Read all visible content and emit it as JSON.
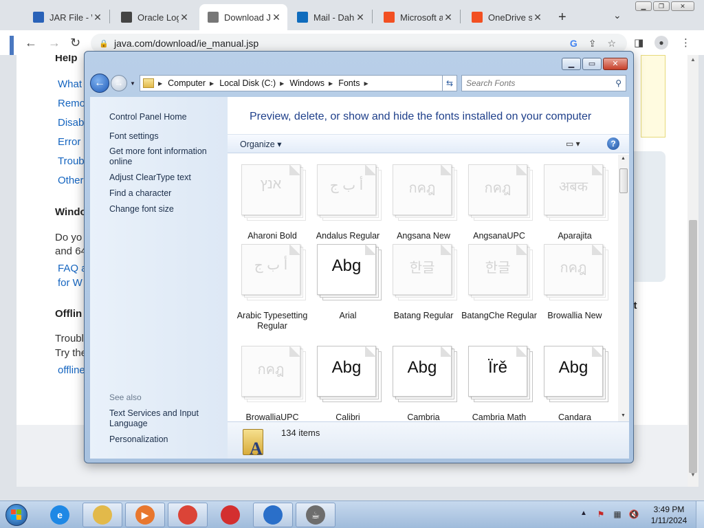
{
  "browser": {
    "tabs": [
      {
        "title": "JAR File - W",
        "favicon": "jar-file-icon",
        "color": "#2962b8"
      },
      {
        "title": "Oracle Login",
        "favicon": "oracle-icon",
        "color": "#444444"
      },
      {
        "title": "Download J",
        "favicon": "java-icon",
        "color": "#777777",
        "active": true
      },
      {
        "title": "Mail - Dahu",
        "favicon": "outlook-icon",
        "color": "#0f6cbd"
      },
      {
        "title": "Microsoft a",
        "favicon": "microsoft-icon",
        "color": "#f25022"
      },
      {
        "title": "OneDrive sy",
        "favicon": "microsoft-icon",
        "color": "#f25022"
      }
    ],
    "new_tab": "+",
    "url": "java.com/download/ie_manual.jsp"
  },
  "page": {
    "help_heading": "Help",
    "help_links": [
      "What",
      "Remo",
      "Disab",
      "Error",
      "Troub",
      "Other"
    ],
    "windows_heading": "Windo",
    "windows_text": [
      "Do yo",
      "and 64"
    ],
    "faq_links": [
      "FAQ a",
      "for W"
    ],
    "offline_heading": "Offlin",
    "offline_text": [
      "Troubl",
      "Try the"
    ],
    "offline_link": "offline",
    "start_text": "start"
  },
  "explorer": {
    "breadcrumbs": [
      "Computer",
      "Local Disk (C:)",
      "Windows",
      "Fonts"
    ],
    "search_placeholder": "Search Fonts",
    "nav": {
      "home": "Control Panel Home",
      "links": [
        "Font settings",
        "Get more font information online",
        "Adjust ClearType text",
        "Find a character",
        "Change font size"
      ],
      "see_also_heading": "See also",
      "see_also": [
        "Text Services and Input Language",
        "Personalization"
      ]
    },
    "title": "Preview, delete, or show and hide the fonts installed on your computer",
    "organize": "Organize",
    "fonts": [
      {
        "name": "Aharoni Bold",
        "sample": "אנץ",
        "faded": true
      },
      {
        "name": "Andalus Regular",
        "sample": "أ ب ج",
        "faded": true
      },
      {
        "name": "Angsana New",
        "sample": "กคฎ",
        "faded": true
      },
      {
        "name": "AngsanaUPC",
        "sample": "กคฎ",
        "faded": true
      },
      {
        "name": "Aparajita",
        "sample": "अबक",
        "faded": true
      },
      {
        "name": "Arabic Typesetting Regular",
        "sample": "أ ب ج",
        "faded": true
      },
      {
        "name": "Arial",
        "sample": "Abg",
        "faded": false
      },
      {
        "name": "Batang Regular",
        "sample": "한글",
        "faded": true
      },
      {
        "name": "BatangChe Regular",
        "sample": "한글",
        "faded": true
      },
      {
        "name": "Browallia New",
        "sample": "กคฎ",
        "faded": true
      },
      {
        "name": "BrowalliaUPC",
        "sample": "กคฎ",
        "faded": true
      },
      {
        "name": "Calibri",
        "sample": "Abg",
        "faded": false
      },
      {
        "name": "Cambria",
        "sample": "Abg",
        "faded": false
      },
      {
        "name": "Cambria Math",
        "sample": "Ïrě",
        "faded": false
      },
      {
        "name": "Candara",
        "sample": "Abg",
        "faded": false
      }
    ],
    "item_count": "134 items"
  },
  "taskbar": {
    "apps": [
      {
        "name": "internet-explorer-icon",
        "label": "e",
        "color": "#1e88e5"
      },
      {
        "name": "file-explorer-icon",
        "label": "",
        "color": "#e2b94a"
      },
      {
        "name": "media-player-icon",
        "label": "▶",
        "color": "#e8772e"
      },
      {
        "name": "chrome-icon",
        "label": "",
        "color": "#db4437"
      },
      {
        "name": "red-app-icon",
        "label": "",
        "color": "#d32f2f"
      },
      {
        "name": "thunderbird-icon",
        "label": "",
        "color": "#2a6fc9"
      },
      {
        "name": "java-icon",
        "label": "☕",
        "color": "#6d6d6d"
      }
    ],
    "time": "3:49 PM",
    "date": "1/11/2024"
  }
}
